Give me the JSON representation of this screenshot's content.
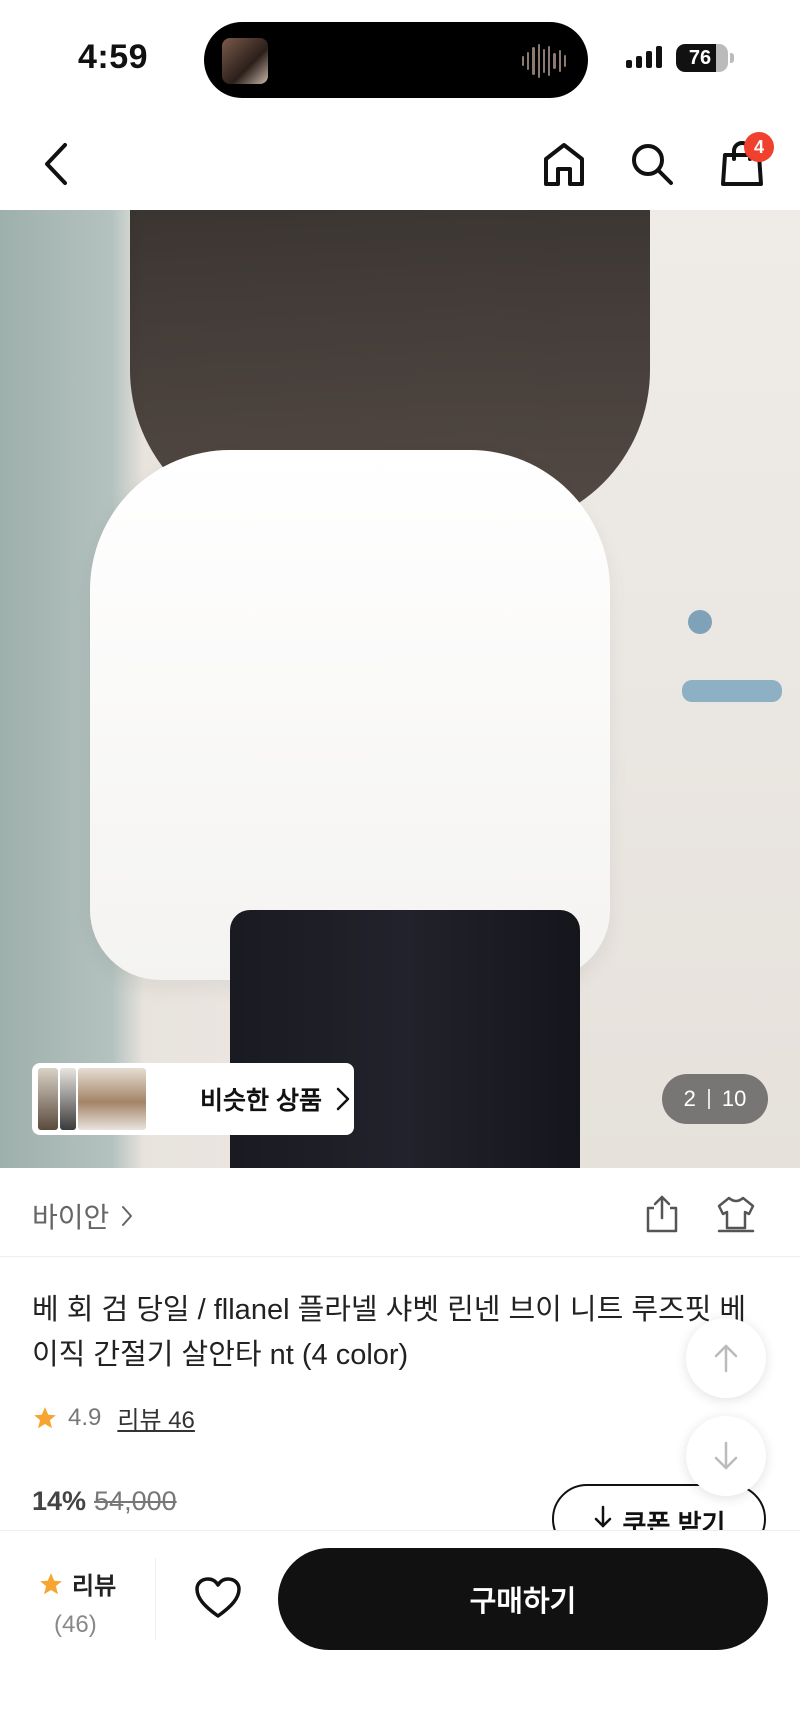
{
  "status_bar": {
    "time": "4:59",
    "battery_level": "76",
    "battery_fraction": 0.76
  },
  "nav": {
    "back_icon": "chevron-left-icon",
    "home_icon": "home-icon",
    "search_icon": "search-icon",
    "cart_icon": "shopping-bag-icon",
    "cart_badge": "4"
  },
  "gallery": {
    "similar_label": "비슷한 상품",
    "current_index": "2",
    "total": "10"
  },
  "product": {
    "brand": "바이안",
    "title": "베 회 검 당일 / fllanel 플라넬 샤벳 린넨 브이 니트 루즈핏 베이직 간절기 살안타 nt (4 color)",
    "rating": "4.9",
    "review_link": "리뷰 46",
    "discount": "14%",
    "original_price": "54,000",
    "coupon_label": "쿠폰 받기"
  },
  "bottom_bar": {
    "review_label": "리뷰",
    "review_count": "(46)",
    "buy_label": "구매하기"
  },
  "colors": {
    "accent": "#111111",
    "badge": "#f0412f",
    "star": "#f7a531"
  }
}
